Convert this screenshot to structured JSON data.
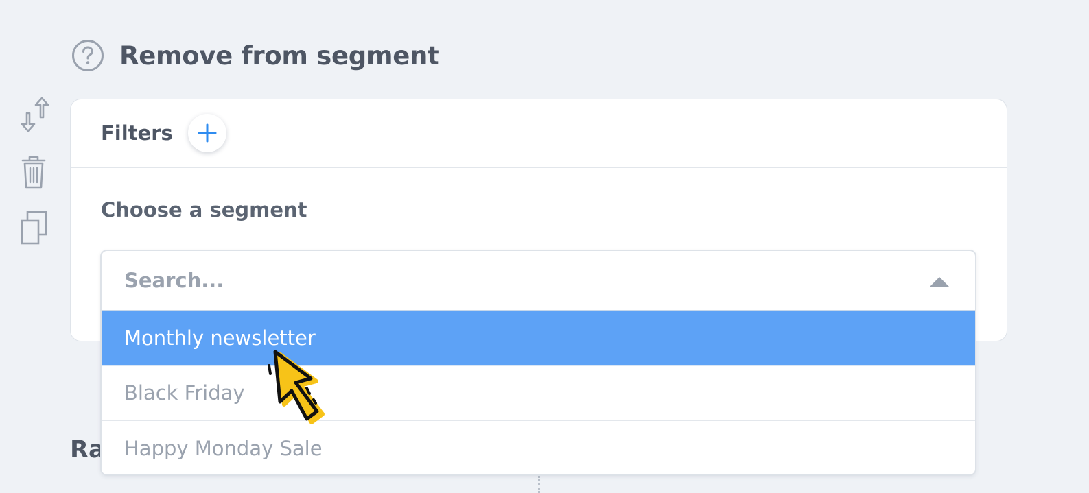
{
  "step": {
    "title": "Remove from segment"
  },
  "filters": {
    "label": "Filters"
  },
  "segment": {
    "label": "Choose a segment",
    "search_placeholder": "Search...",
    "options": [
      {
        "label": "Monthly newsletter",
        "selected": true
      },
      {
        "label": "Black Friday",
        "selected": false
      },
      {
        "label": "Happy Monday Sale",
        "selected": false
      }
    ]
  },
  "next_section": {
    "partial_title": "Ra"
  },
  "icons": {
    "help": "help-circle-icon",
    "reorder": "swap-vertical-icon",
    "delete": "trash-icon",
    "duplicate": "copy-icon",
    "add": "plus-icon",
    "caret": "caret-up-icon",
    "pointer": "cursor-icon"
  },
  "colors": {
    "background": "#eff2f6",
    "accent": "#2f8cf0",
    "selected_option": "#5da2f6",
    "cursor": "#f7c318"
  }
}
